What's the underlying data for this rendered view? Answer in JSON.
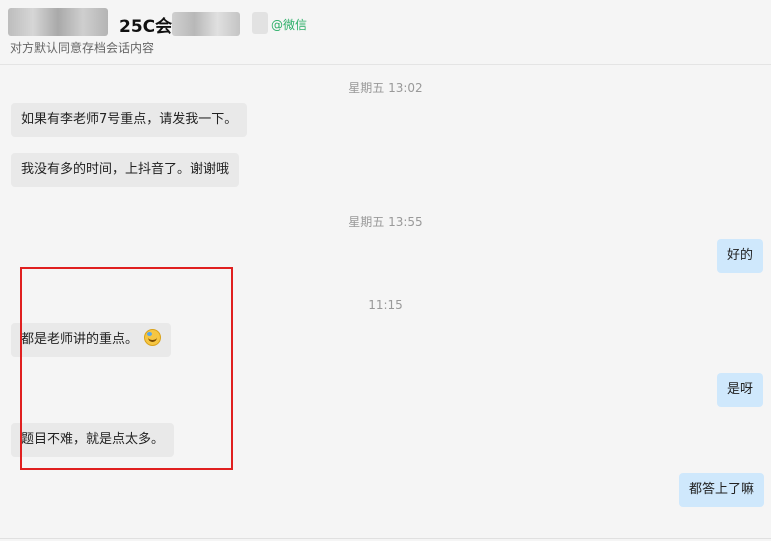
{
  "header": {
    "title": "25C会",
    "wechat_tag": "@微信",
    "subtitle": "对方默认同意存档会话内容"
  },
  "timestamps": [
    "星期五 13:02",
    "星期五 13:55",
    "11:15"
  ],
  "messages": [
    {
      "text": "如果有李老师7号重点，请发我一下。",
      "side": "left"
    },
    {
      "text": "我没有多的时间，上抖音了。谢谢哦",
      "side": "left"
    },
    {
      "text": "好的",
      "side": "right"
    },
    {
      "text": "都是老师讲的重点。",
      "side": "left",
      "emoji": "grinning-sweat-emoji"
    },
    {
      "text": "是呀",
      "side": "right"
    },
    {
      "text": "题目不难，就是点太多。",
      "side": "left"
    },
    {
      "text": "都答上了嘛",
      "side": "right"
    }
  ],
  "colors": {
    "left_bubble": "#e9e9e9",
    "right_bubble": "#cfe8fc",
    "highlight": "#e02020",
    "wechat_green": "#2aae67"
  }
}
